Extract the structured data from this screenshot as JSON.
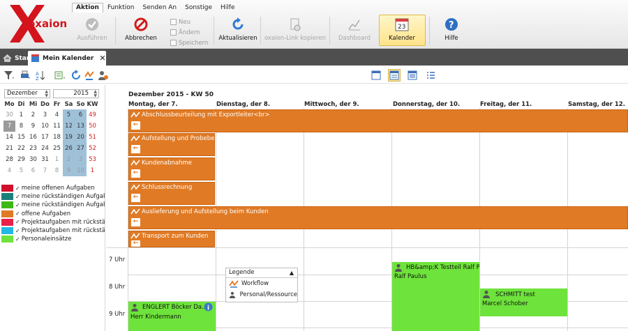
{
  "app": {
    "logo_text": "oxaion"
  },
  "menu": [
    "Aktion",
    "Funktion",
    "Senden An",
    "Sonstige",
    "Hilfe"
  ],
  "ribbon": {
    "ausfuehren": "Ausführen",
    "abbrechen": "Abbrechen",
    "neu": "Neu",
    "aendern": "Ändern",
    "speichern": "Speichern",
    "aktualisieren": "Aktualisieren",
    "link": "oxaion-Link kopieren",
    "dashboard": "Dashboard",
    "kalender": "Kalender",
    "kalender_day": "23",
    "hilfe": "Hilfe"
  },
  "tabs": {
    "start": "Start",
    "calendar": "Mein Kalender"
  },
  "mini": {
    "month": "Dezember",
    "year": "2015",
    "headers": [
      "Mo",
      "Di",
      "Mi",
      "Do",
      "Fr",
      "Sa",
      "So",
      "KW"
    ],
    "rows": [
      [
        "30",
        "1",
        "2",
        "3",
        "4",
        "5",
        "6",
        "49"
      ],
      [
        "7",
        "8",
        "9",
        "10",
        "11",
        "12",
        "13",
        "50"
      ],
      [
        "14",
        "15",
        "16",
        "17",
        "18",
        "19",
        "20",
        "51"
      ],
      [
        "21",
        "22",
        "23",
        "24",
        "25",
        "26",
        "27",
        "52"
      ],
      [
        "28",
        "29",
        "30",
        "31",
        "1",
        "2",
        "3",
        "53"
      ],
      [
        "4",
        "5",
        "6",
        "7",
        "8",
        "9",
        "10",
        "1"
      ]
    ]
  },
  "legend_list": [
    {
      "label": "meine offenen Aufgaben",
      "color": "#d0102c"
    },
    {
      "label": "meine rückständigen Aufgab",
      "color": "#1a7f7a"
    },
    {
      "label": "meine rückständigen Aufgab",
      "color": "#3fb816"
    },
    {
      "label": "offene Aufgaben",
      "color": "#e07a24"
    },
    {
      "label": "Projektaufgaben mit rückstä",
      "color": "#e8204a"
    },
    {
      "label": "Projektaufgaben mit rückstä",
      "color": "#21b8e6"
    },
    {
      "label": "Personaleinsätze",
      "color": "#6ee33b"
    }
  ],
  "week": {
    "title": "Dezember 2015 - KW 50",
    "days": [
      "Montag, der 7.",
      "Dienstag, der 8.",
      "Mittwoch, der 9.",
      "Donnerstag, der 10.",
      "Freitag, der 11.",
      "Samstag, der 12."
    ]
  },
  "tasks": {
    "t1": "Abschlussbeurteilung mit Exportleiter<br>",
    "t2": "Aufstellung und Probebet",
    "t3": "Kundenabnahme",
    "t4": "Schlussrechnung",
    "t5": "Auslieferung und Aufstellung beim Kunden",
    "t6": "Transport zum Kunden"
  },
  "hours": [
    "7 Uhr",
    "8 Uhr",
    "9 Uhr"
  ],
  "appointments": {
    "a1_title": "HB&amp;K Testteil Ralf Pau",
    "a1_person": "Ralf Paulus",
    "a2_title": "SCHMITT test",
    "a2_person": "Marcel Schober",
    "a3_title": "ENGLERT Böcker Da...",
    "a3_person": "Herr Kindermann"
  },
  "legend_popup": {
    "title": "Legende",
    "workflow": "Workflow",
    "person": "Personal/Ressource"
  }
}
